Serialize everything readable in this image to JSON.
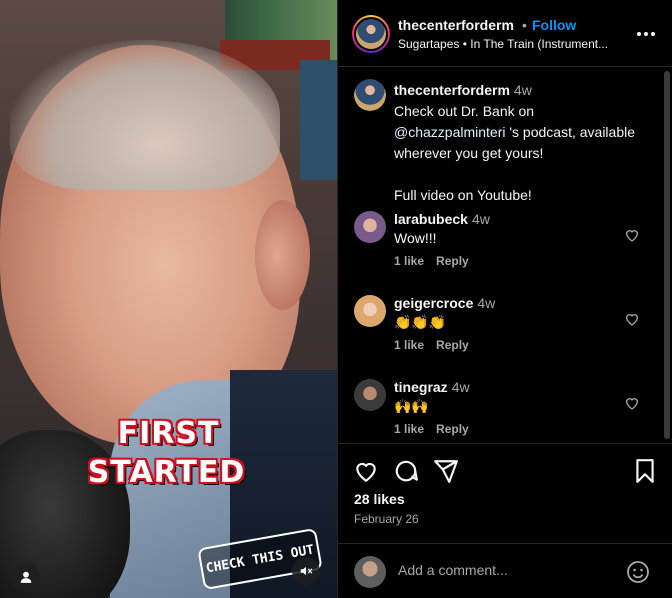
{
  "post": {
    "username": "thecenterforderm",
    "follow_label": "Follow",
    "separator": "•",
    "music": "Sugartapes • In The Train (Instrument..."
  },
  "media": {
    "caption_line1": "FIRST",
    "caption_line2": "STARTED",
    "sticker": "CHECK THIS OUT"
  },
  "caption": {
    "username": "thecenterforderm",
    "time": "4w",
    "text_before": "Check out Dr. Bank on ",
    "mention": "@chazzpalminteri",
    "text_after": " 's podcast, available wherever you get yours!",
    "text_line2": "Full video on Youtube!"
  },
  "comments": [
    {
      "username": "larabubeck",
      "time": "4w",
      "text": "Wow!!!",
      "likes": "1 like",
      "reply": "Reply",
      "avatar_color": "#7a5a8a"
    },
    {
      "username": "geigercroce",
      "time": "4w",
      "text": "👏👏👏",
      "likes": "1 like",
      "reply": "Reply",
      "avatar_color": "#d9a86a"
    },
    {
      "username": "tinegraz",
      "time": "4w",
      "text": "🙌🙌",
      "likes": "1 like",
      "reply": "Reply",
      "avatar_color": "#3b3b3b"
    }
  ],
  "stats": {
    "likes": "28 likes",
    "date": "February 26"
  },
  "add_comment": {
    "placeholder": "Add a comment..."
  },
  "icons": {
    "like": "heart-icon",
    "comment": "comment-icon",
    "share": "share-icon",
    "save": "bookmark-icon",
    "more": "more-icon",
    "emoji": "emoji-icon",
    "mute": "mute-icon",
    "tag": "user-tag-icon"
  },
  "colors": {
    "accent": "#0095f6",
    "secondary_text": "#a8a8a8",
    "divider": "#262626"
  }
}
